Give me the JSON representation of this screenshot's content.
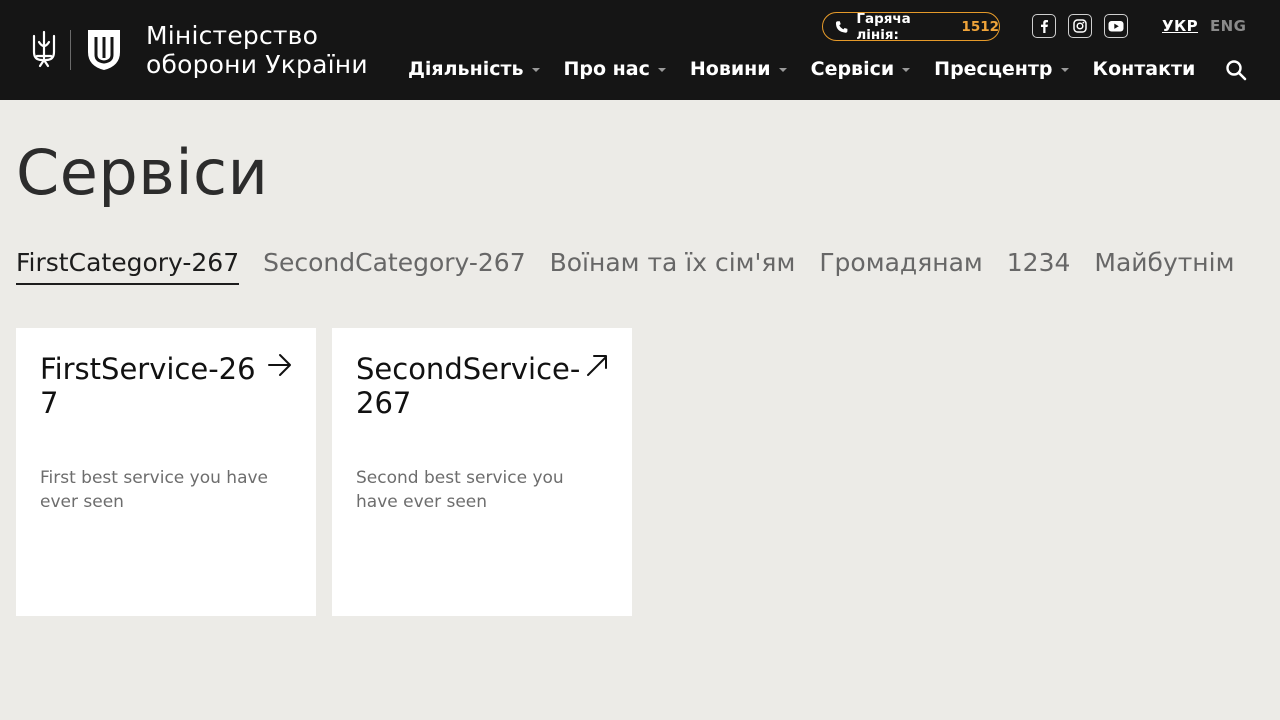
{
  "header": {
    "ministry_name_line1": "Міністерство",
    "ministry_name_line2": "оборони України",
    "hotline_label": "Гаряча лінія:",
    "hotline_number": "1512",
    "social": [
      "facebook-icon",
      "instagram-icon",
      "youtube-icon"
    ],
    "languages": {
      "active": "УКР",
      "other": "ENG"
    },
    "nav": [
      {
        "label": "Діяльність",
        "has_dropdown": true
      },
      {
        "label": "Про нас",
        "has_dropdown": true
      },
      {
        "label": "Новини",
        "has_dropdown": true
      },
      {
        "label": "Сервіси",
        "has_dropdown": true
      },
      {
        "label": "Пресцентр",
        "has_dropdown": true
      },
      {
        "label": "Контакти",
        "has_dropdown": false
      }
    ]
  },
  "main": {
    "title": "Сервіси",
    "tabs": [
      {
        "label": "FirstCategory-267",
        "active": true
      },
      {
        "label": "SecondCategory-267",
        "active": false
      },
      {
        "label": "Воїнам та їх сім'ям",
        "active": false
      },
      {
        "label": "Громадянам",
        "active": false
      },
      {
        "label": "1234",
        "active": false
      },
      {
        "label": "Майбутнім",
        "active": false
      }
    ],
    "cards": [
      {
        "title": "FirstService-267",
        "description": "First best service you have ever seen",
        "icon": "arrow-right-icon"
      },
      {
        "title": "SecondService-267",
        "description": "Second best service you have ever seen",
        "icon": "external-link-icon"
      }
    ]
  },
  "colors": {
    "header_bg": "#151515",
    "page_bg": "#ecebe7",
    "accent": "#f0a43a",
    "card_bg": "#ffffff"
  }
}
